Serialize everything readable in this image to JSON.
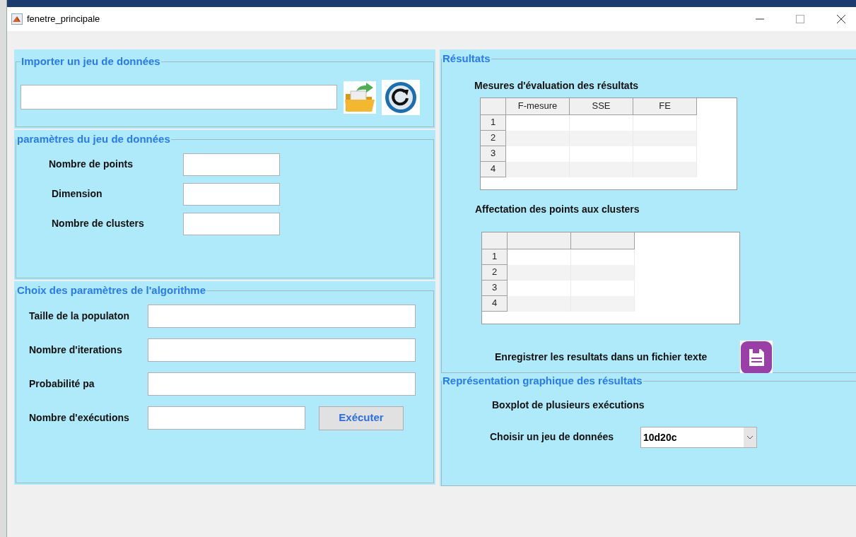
{
  "window": {
    "title": "fenetre_principale"
  },
  "import_panel": {
    "title": "Importer un jeu de données"
  },
  "dataset_panel": {
    "title": "paramètres du jeu de données",
    "fields": [
      {
        "label": "Nombre de points"
      },
      {
        "label": "Dimension"
      },
      {
        "label": "Nombre de clusters"
      }
    ]
  },
  "algorithm_panel": {
    "title": "Choix des paramètres de l'algorithme",
    "fields": [
      {
        "label": "Taille de la populaton"
      },
      {
        "label": "Nombre d'iterations"
      },
      {
        "label": "Probabilité pa"
      },
      {
        "label": "Nombre d'exécutions"
      }
    ],
    "button": "Exécuter"
  },
  "results_panel": {
    "title": "Résultats",
    "measures_table": {
      "title": "Mesures d'évaluation des résultats",
      "columns": [
        "F-mesure",
        "SSE",
        "FE"
      ],
      "row_headers": [
        "1",
        "2",
        "3",
        "4"
      ]
    },
    "assignment_table": {
      "title": "Affectation des points aux clusters",
      "row_headers": [
        "1",
        "2",
        "3",
        "4"
      ]
    },
    "save_label": "Enregistrer les resultats dans un fichier texte"
  },
  "graph_panel": {
    "title": "Représentation graphique des résultats",
    "subtitle": "Boxplot de plusieurs exécutions",
    "select_label": "Choisir un jeu de données",
    "select_value": "10d20c"
  }
}
